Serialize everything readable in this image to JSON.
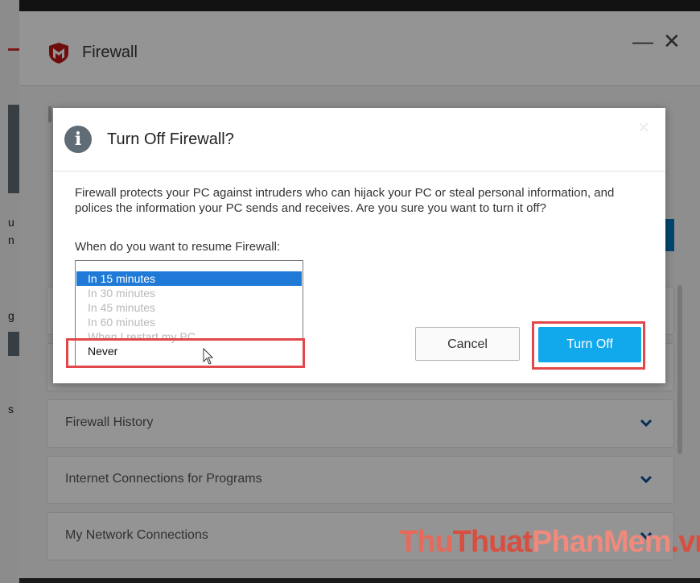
{
  "window": {
    "title": "Firewall",
    "minimize_symbol": "—",
    "close_symbol": "✕"
  },
  "sections": [
    {
      "label": "Firewall History"
    },
    {
      "label": "Internet Connections for Programs"
    },
    {
      "label": "My Network Connections"
    }
  ],
  "dialog": {
    "title": "Turn Off Firewall?",
    "message": "Firewall protects your PC against intruders who can hijack your PC or steal personal information, and polices the information your PC sends and receives. Are you sure you want to turn it off?",
    "question": "When do you want to resume Firewall:",
    "options": [
      "In 15 minutes",
      "In 30 minutes",
      "In 45 minutes",
      "In 60 minutes",
      "When I restart my PC",
      "Never"
    ],
    "selected_option": "In 15 minutes",
    "cancel_label": "Cancel",
    "turn_off_label": "Turn Off"
  },
  "watermark": {
    "part1": "Thu",
    "part2": "Thuat",
    "part3": "PhanMem",
    "part4": ".vn"
  },
  "colors": {
    "accent": "#12a9ec",
    "selection": "#1e7ad6",
    "highlight": "#e2474b",
    "brand": "#c01818"
  }
}
